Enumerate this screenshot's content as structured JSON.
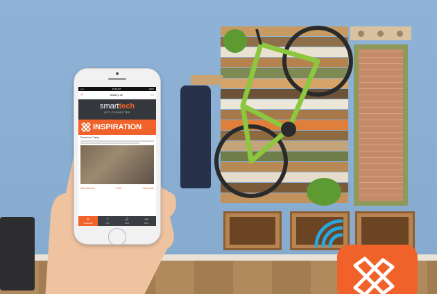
{
  "status_bar": {
    "carrier": "••••• ",
    "time": "11:58 AM",
    "battery": "100%"
  },
  "nav": {
    "back": "<",
    "title": "Battery #2",
    "icons": "? ?"
  },
  "brand": {
    "name_plain": "smart",
    "name_accent": "tech",
    "tagline": "GET CONNECTED"
  },
  "inspiration_label": "INSPIRATION",
  "post": {
    "title": "Pinned for Cutting",
    "foot_left": "Add Comment",
    "foot_mid": "0 Like",
    "foot_right": "Leave Note"
  },
  "tabs": [
    {
      "icon": "✶",
      "label": "Inspiration"
    },
    {
      "icon": "†",
      "label": "Craft"
    },
    {
      "icon": "☰",
      "label": "Build"
    },
    {
      "icon": "•••",
      "label": "More"
    }
  ],
  "colors": {
    "accent": "#f0622a",
    "dark": "#34383d",
    "wall": "#8fb3d6"
  }
}
